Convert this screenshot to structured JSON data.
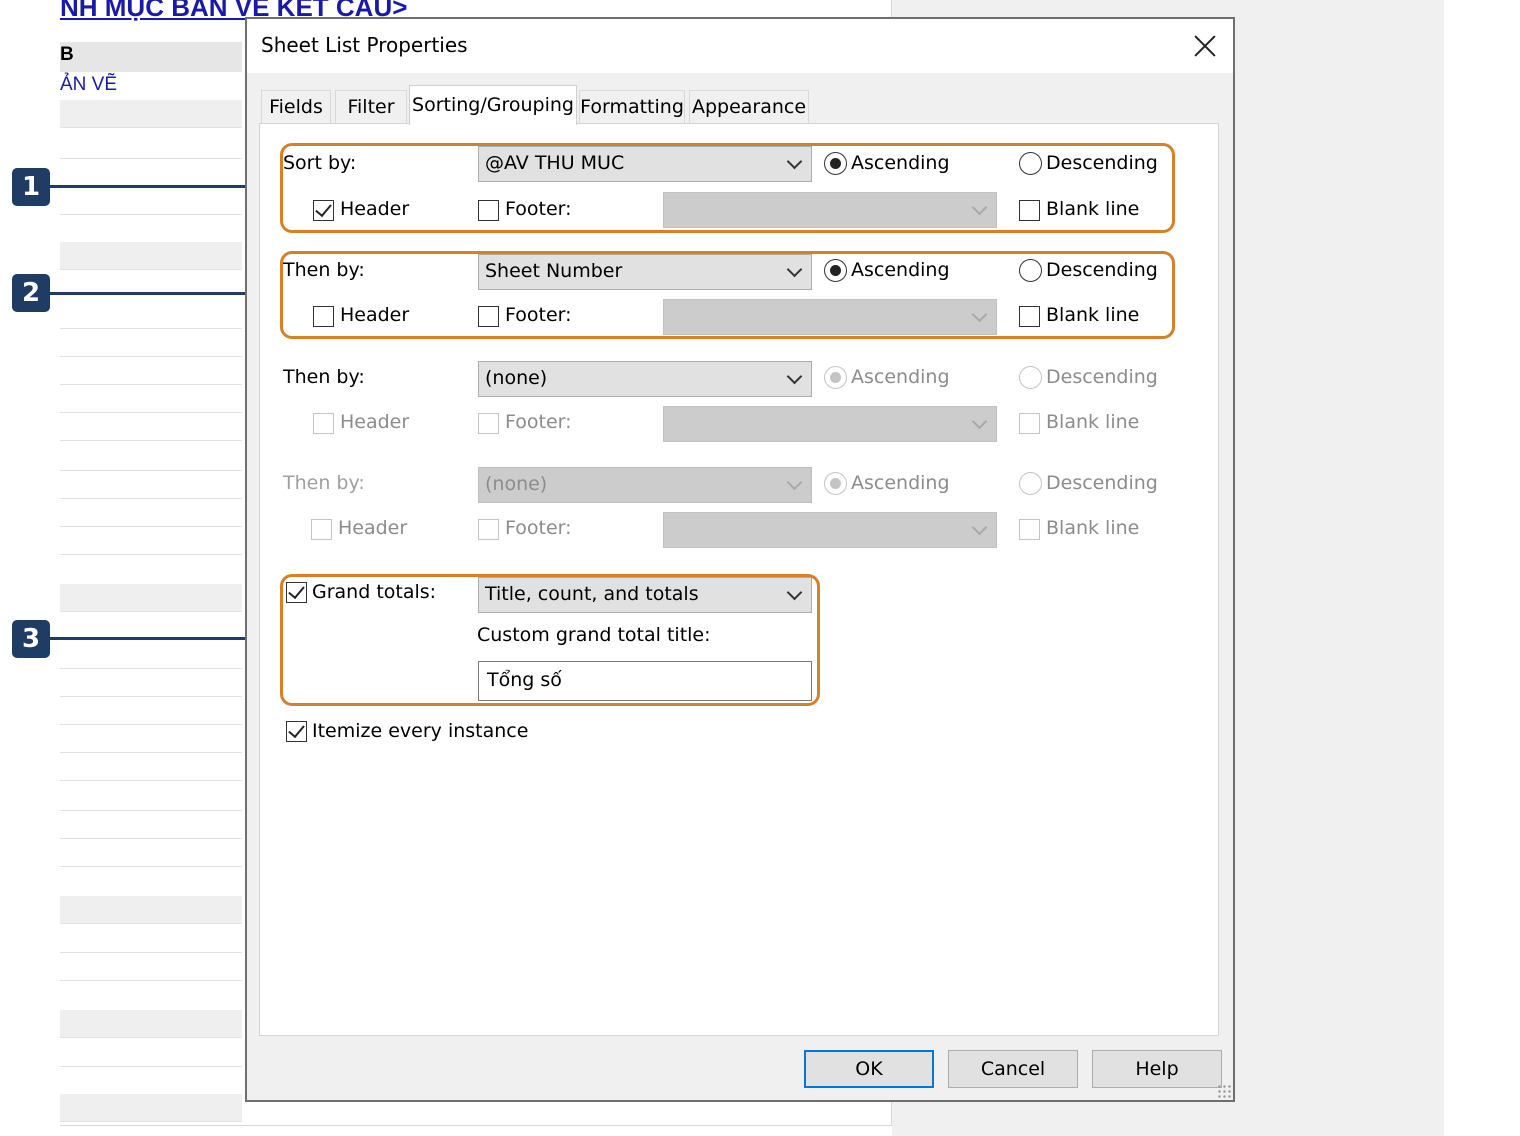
{
  "background": {
    "title": "NH MỤC BẢN VẼ KẾT CẤU>",
    "header": "B",
    "subheader": "ẢN VẼ"
  },
  "callouts": [
    "1",
    "2",
    "3"
  ],
  "dialog": {
    "title": "Sheet List Properties",
    "tabs": [
      {
        "label": "Fields"
      },
      {
        "label": "Filter"
      },
      {
        "label": "Sorting/Grouping"
      },
      {
        "label": "Formatting"
      },
      {
        "label": "Appearance"
      }
    ],
    "sort_groups": [
      {
        "label": "Sort by:",
        "field": "@AV THU MUC",
        "ascending": "Ascending",
        "descending": "Descending",
        "header": "Header",
        "footer": "Footer:",
        "blank_line": "Blank line"
      },
      {
        "label": "Then by:",
        "field": "Sheet Number",
        "ascending": "Ascending",
        "descending": "Descending",
        "header": "Header",
        "footer": "Footer:",
        "blank_line": "Blank line"
      },
      {
        "label": "Then by:",
        "field": "(none)",
        "ascending": "Ascending",
        "descending": "Descending",
        "header": "Header",
        "footer": "Footer:",
        "blank_line": "Blank line"
      },
      {
        "label": "Then by:",
        "field": "(none)",
        "ascending": "Ascending",
        "descending": "Descending",
        "header": "Header",
        "footer": "Footer:",
        "blank_line": "Blank line"
      }
    ],
    "grand_totals": {
      "label": "Grand totals:",
      "value": "Title, count, and totals",
      "custom_title_label": "Custom grand total title:",
      "custom_title_value": "Tổng số"
    },
    "itemize_label": "Itemize every instance",
    "buttons": {
      "ok": "OK",
      "cancel": "Cancel",
      "help": "Help"
    }
  },
  "colors": {
    "highlight": "#d4822a",
    "callout": "#1f3c65",
    "default_button": "#0078d7"
  }
}
